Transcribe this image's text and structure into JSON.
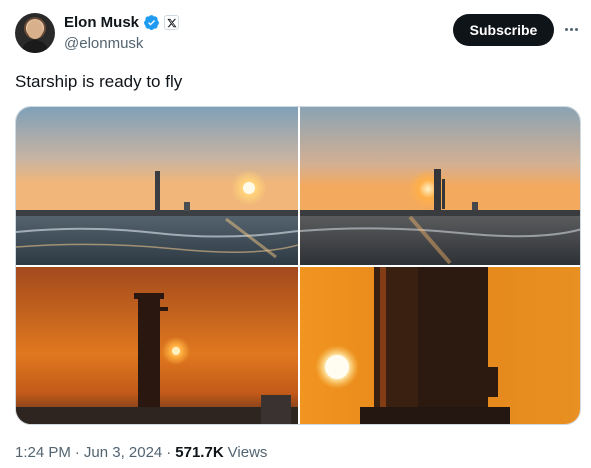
{
  "author": {
    "display_name": "Elon Musk",
    "handle": "@elonmusk",
    "verified_icon": "verified-badge",
    "affiliate_icon": "x-logo"
  },
  "actions": {
    "subscribe_label": "Subscribe",
    "more_icon": "more-horizontal"
  },
  "tweet": {
    "text": "Starship is ready to fly"
  },
  "media": {
    "count": 4
  },
  "meta": {
    "time": "1:24 PM",
    "sep1": "·",
    "date": "Jun 3, 2024",
    "sep2": "·",
    "views_count": "571.7K",
    "views_label": "Views"
  },
  "colors": {
    "text_primary": "#0f1419",
    "text_secondary": "#536471",
    "verified_blue": "#1d9bf0",
    "subscribe_bg": "#0f1419",
    "border": "#cfd9de"
  }
}
